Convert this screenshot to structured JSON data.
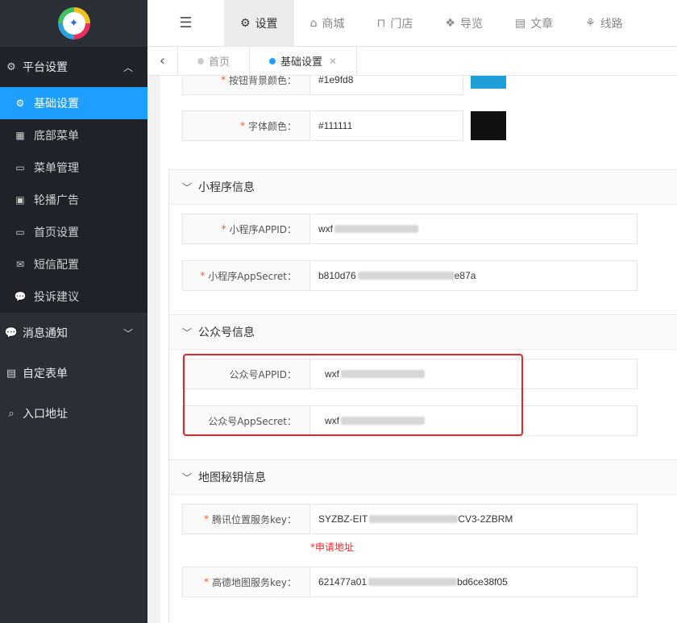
{
  "sidebar": {
    "groups": [
      {
        "label": "平台设置",
        "icon": "gear-icon"
      },
      {
        "label": "消息通知",
        "icon": "chat-icon"
      },
      {
        "label": "自定表单",
        "icon": "form-icon"
      },
      {
        "label": "入口地址",
        "icon": "search-icon"
      }
    ],
    "items": [
      {
        "label": "基础设置",
        "icon": "gear-icon"
      },
      {
        "label": "底部菜单",
        "icon": "grid-icon"
      },
      {
        "label": "菜单管理",
        "icon": "monitor-icon"
      },
      {
        "label": "轮播广告",
        "icon": "image-icon"
      },
      {
        "label": "首页设置",
        "icon": "monitor-icon"
      },
      {
        "label": "短信配置",
        "icon": "mail-icon"
      },
      {
        "label": "投诉建议",
        "icon": "chat-icon"
      }
    ]
  },
  "topbar": {
    "tabs": [
      {
        "label": "设置",
        "icon": "gears-icon"
      },
      {
        "label": "商城",
        "icon": "shop-icon"
      },
      {
        "label": "门店",
        "icon": "bank-icon"
      },
      {
        "label": "导览",
        "icon": "cubes-icon"
      },
      {
        "label": "文章",
        "icon": "news-icon"
      },
      {
        "label": "线路",
        "icon": "route-icon"
      }
    ]
  },
  "pagetabs": {
    "tabs": [
      {
        "label": "首页"
      },
      {
        "label": "基础设置"
      }
    ]
  },
  "form": {
    "top_partial": {
      "label": "按钮背景颜色：",
      "value": "#1e9fd8"
    },
    "font_color": {
      "label": "字体颜色：",
      "value": "#111111",
      "swatch": "#111111"
    },
    "button_swatch": "#1e9fd8",
    "mini": {
      "title": "小程序信息",
      "appid_label": "小程序APPID：",
      "appid_value": "wxf",
      "secret_label": "小程序AppSecret：",
      "secret_prefix": "b810d76",
      "secret_suffix": "e87a"
    },
    "mp": {
      "title": "公众号信息",
      "appid_label": "公众号APPID：",
      "appid_value": "wxf",
      "secret_label": "公众号AppSecret：",
      "secret_value": "wxf"
    },
    "map": {
      "title": "地图秘钥信息",
      "tencent_label": "腾讯位置服务key：",
      "tencent_prefix": "SYZBZ-EIT",
      "tencent_suffix": "CV3-2ZBRM",
      "apply_link": "*申请地址",
      "amap_label": "高德地图服务key：",
      "amap_prefix": "621477a01",
      "amap_suffix": "bd6ce38f05"
    }
  },
  "colors": {
    "sidebar_bg": "#2a2f36",
    "active": "#1e9fff",
    "required": "#ff5722",
    "highlight_box": "#e4262b"
  }
}
